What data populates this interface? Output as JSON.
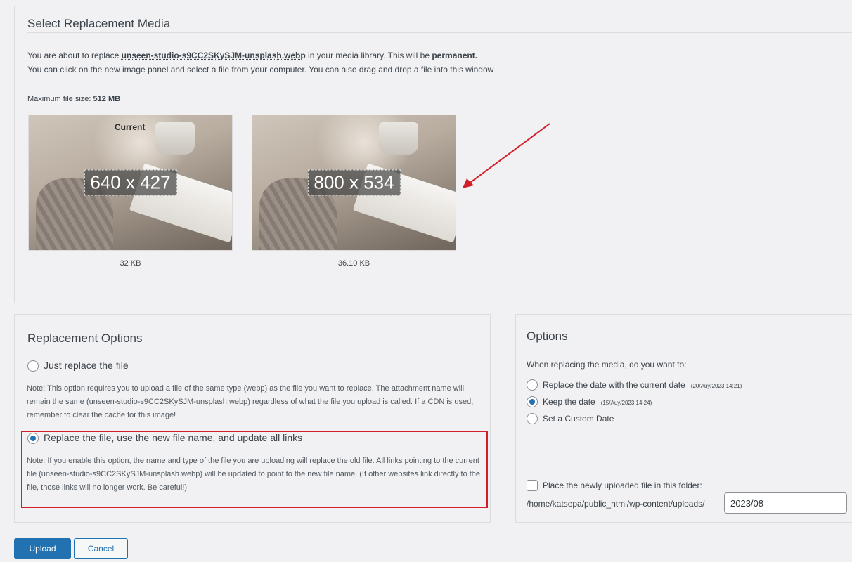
{
  "select_media": {
    "title": "Select Replacement Media",
    "line1_prefix": "You are about to replace ",
    "line1_filename": "unseen-studio-s9CC2SKySJM-unsplash.webp",
    "line1_middle": " in your media library. This will be ",
    "line1_strong": "permanent.",
    "line2": "You can click on the new image panel and select a file from your computer. You can also drag and drop a file into this window",
    "max_size_label": "Maximum file size: ",
    "max_size_value": "512 MB",
    "current_label": "Current",
    "current_dims": "640 x 427",
    "current_size": "32 KB",
    "new_dims": "800 x 534",
    "new_size": "36.10 KB"
  },
  "replacement_options": {
    "title": "Replacement Options",
    "option1_label": "Just replace the file",
    "option1_note": "Note: This option requires you to upload a file of the same type (webp) as the file you want to replace. The attachment name will remain the same (unseen-studio-s9CC2SKySJM-unsplash.webp) regardless of what the file you upload is called. If a CDN is used, remember to clear the cache for this image!",
    "option2_label": "Replace the file, use the new file name, and update all links",
    "option2_note": "Note: If you enable this option, the name and type of the file you are uploading will replace the old file. All links pointing to the current file (unseen-studio-s9CC2SKySJM-unsplash.webp) will be updated to point to the new file name. (If other websites link directly to the file, those links will no longer work. Be careful!)"
  },
  "options": {
    "title": "Options",
    "question": "When replacing the media, do you want to:",
    "date_current_label": "Replace the date with the current date",
    "date_current_note": "(20/Auy/2023 14:21)",
    "keep_date_label": "Keep the date",
    "keep_date_note": "(15/Auy/2023 14:24)",
    "custom_date_label": "Set a Custom Date",
    "folder_label": "Place the newly uploaded file in this folder:",
    "folder_path": "/home/katsepa/public_html/wp-content/uploads/",
    "folder_value": "2023/08"
  },
  "buttons": {
    "upload": "Upload",
    "cancel": "Cancel"
  },
  "colors": {
    "accent": "#2271b1",
    "highlight": "#d11f2a"
  }
}
